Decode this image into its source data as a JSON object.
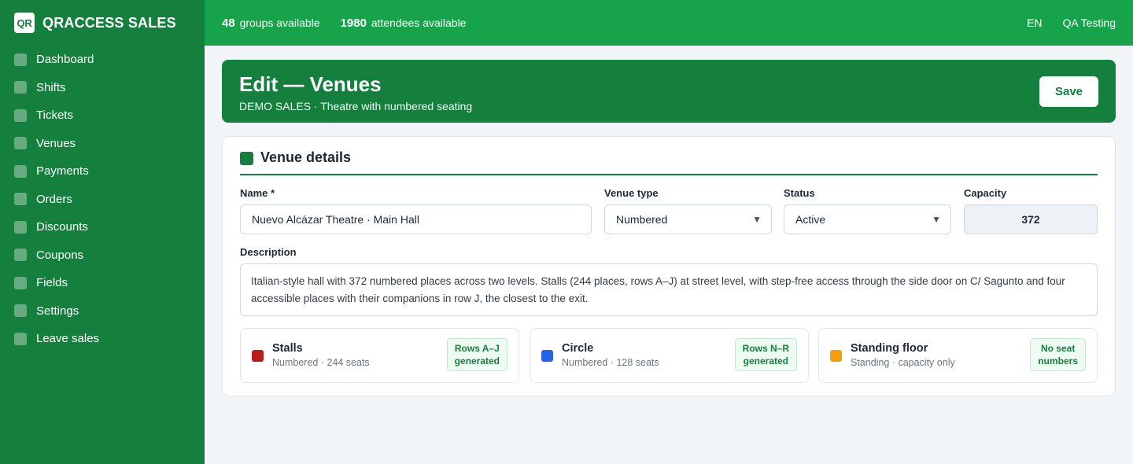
{
  "brand": {
    "logo": "QR",
    "name": "QRACCESS SALES"
  },
  "sidebar": {
    "items": [
      {
        "label": "Dashboard",
        "icon": "dashboard-icon"
      },
      {
        "label": "Shifts",
        "icon": "shifts-icon"
      },
      {
        "label": "Tickets",
        "icon": "tickets-icon"
      },
      {
        "label": "Venues",
        "icon": "venues-icon"
      },
      {
        "label": "Payments",
        "icon": "payments-icon"
      },
      {
        "label": "Orders",
        "icon": "orders-icon"
      },
      {
        "label": "Discounts",
        "icon": "discounts-icon"
      },
      {
        "label": "Coupons",
        "icon": "coupons-icon"
      },
      {
        "label": "Fields",
        "icon": "fields-icon"
      },
      {
        "label": "Settings",
        "icon": "settings-icon"
      },
      {
        "label": "Leave sales",
        "icon": "leave-icon"
      }
    ]
  },
  "topbar": {
    "groups_count": "48",
    "groups_label": "groups available",
    "attendees_count": "1980",
    "attendees_label": "attendees available",
    "language": "EN",
    "user": "QA Testing"
  },
  "banner": {
    "title": "Edit — Venues",
    "subtitle": "DEMO SALES · Theatre with numbered seating",
    "save_label": "Save"
  },
  "venue": {
    "section_title": "Venue details",
    "name_label": "Name *",
    "name_value": "Nuevo Alcázar Theatre · Main Hall",
    "type_label": "Venue type",
    "type_value": "Numbered",
    "status_label": "Status",
    "status_value": "Active",
    "capacity_label": "Capacity",
    "capacity_value": "372",
    "description_label": "Description",
    "description_value": "Italian-style hall with 372 numbered places across two levels. Stalls (244 places, rows A–J) at street level, with step-free access through the side door on C/ Sagunto and four accessible places with their companions in row J, the closest to the exit."
  },
  "zones": [
    {
      "name": "Stalls",
      "meta": "Numbered · 244 seats",
      "badge_line1": "Rows A–J",
      "badge_line2": "generated",
      "color": "#b91c1c"
    },
    {
      "name": "Circle",
      "meta": "Numbered · 128 seats",
      "badge_line1": "Rows N–R",
      "badge_line2": "generated",
      "color": "#2563eb"
    },
    {
      "name": "Standing floor",
      "meta": "Standing · capacity only",
      "badge_line1": "No seat",
      "badge_line2": "numbers",
      "color": "#f59e0b"
    }
  ],
  "colors": {
    "sidebar": "#15803d",
    "topbar": "#16a34a",
    "accent": "#15803d"
  }
}
